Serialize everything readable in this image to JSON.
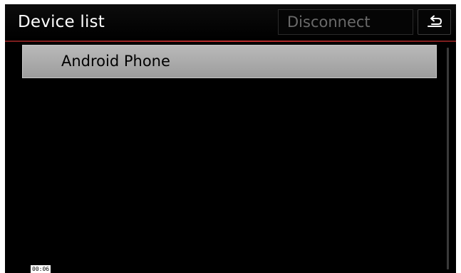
{
  "header": {
    "title": "Device list",
    "disconnect_label": "Disconnect",
    "back_icon": "back-arrow-icon"
  },
  "devices": [
    {
      "label": "Android Phone",
      "selected": true
    }
  ],
  "status": {
    "time": "00:06"
  },
  "colors": {
    "background": "#000000",
    "accent_divider": "#c03030",
    "selected_row": "#aaaaaa",
    "disabled_text": "#6a6a6a"
  }
}
